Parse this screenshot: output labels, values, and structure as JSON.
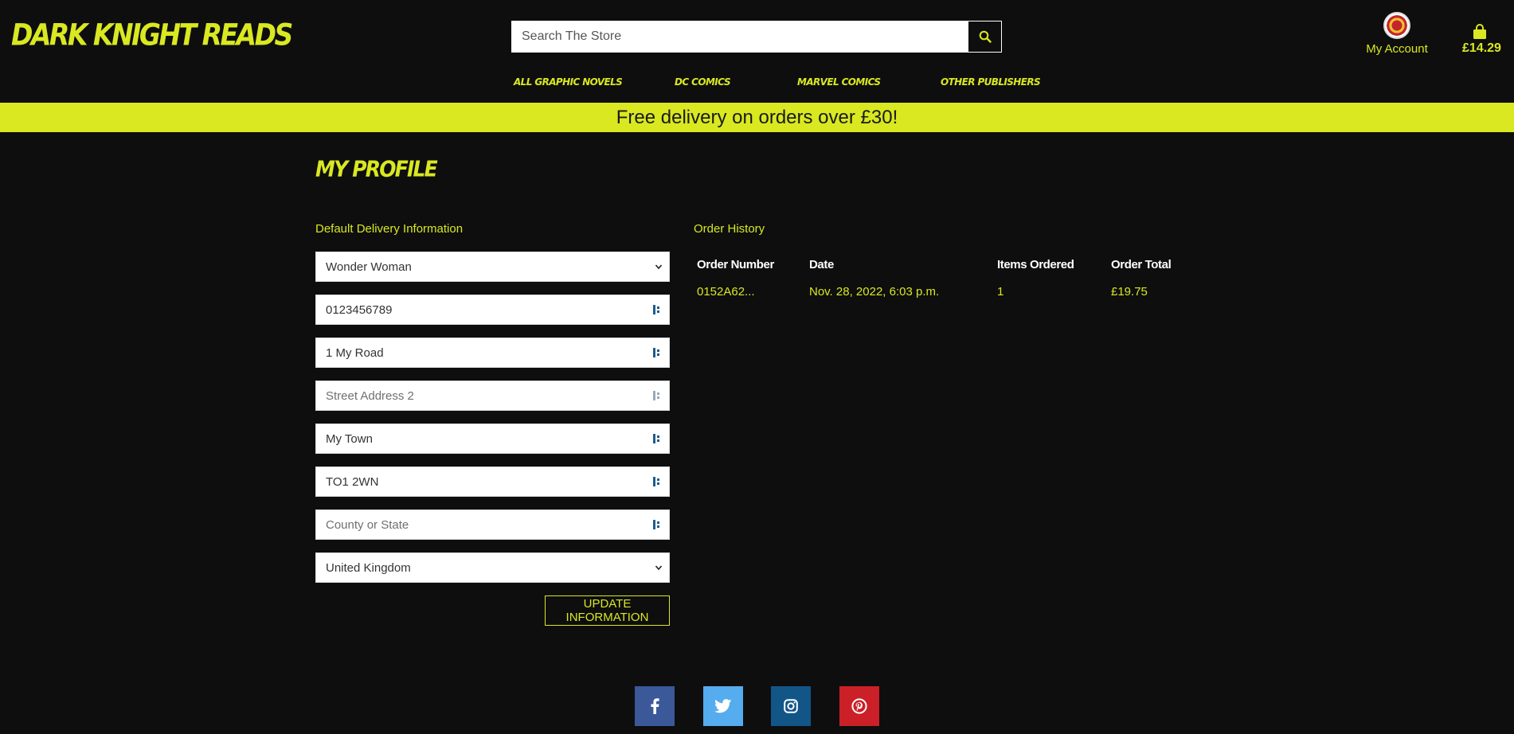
{
  "brand": {
    "name": "DARK KNIGHT READS"
  },
  "search": {
    "placeholder": "Search The Store"
  },
  "account": {
    "label": "My Account"
  },
  "bag": {
    "total": "£14.29"
  },
  "nav": {
    "items": [
      {
        "label": "ALL GRAPHIC NOVELS"
      },
      {
        "label": "DC COMICS"
      },
      {
        "label": "MARVEL COMICS"
      },
      {
        "label": "OTHER PUBLISHERS"
      }
    ]
  },
  "banner": {
    "text": "Free delivery on orders over £30!"
  },
  "profile": {
    "title": "MY PROFILE",
    "delivery_title": "Default Delivery Information",
    "fields": {
      "full_name": {
        "value": "Wonder Woman"
      },
      "phone": {
        "value": "0123456789"
      },
      "street1": {
        "value": "1 My Road"
      },
      "street2": {
        "placeholder": "Street Address 2"
      },
      "town": {
        "value": "My Town"
      },
      "postcode": {
        "value": "TO1 2WN"
      },
      "county": {
        "placeholder": "County or State"
      },
      "country": {
        "value": "United Kingdom"
      }
    },
    "update_label": "UPDATE INFORMATION"
  },
  "orders": {
    "title": "Order History",
    "headers": [
      "Order Number",
      "Date",
      "Items Ordered",
      "Order Total"
    ],
    "rows": [
      [
        "0152A62...",
        "Nov. 28, 2022, 6:03 p.m.",
        "1",
        "£19.75"
      ]
    ]
  },
  "social": {
    "items": [
      {
        "icon": "facebook-icon",
        "color": "#3b5998"
      },
      {
        "icon": "twitter-icon",
        "color": "#55acee"
      },
      {
        "icon": "instagram-icon",
        "color": "#125688"
      },
      {
        "icon": "pinterest-icon",
        "color": "#cb2027"
      }
    ]
  },
  "colors": {
    "accent": "#d9e821",
    "background": "#0e0e0f"
  }
}
